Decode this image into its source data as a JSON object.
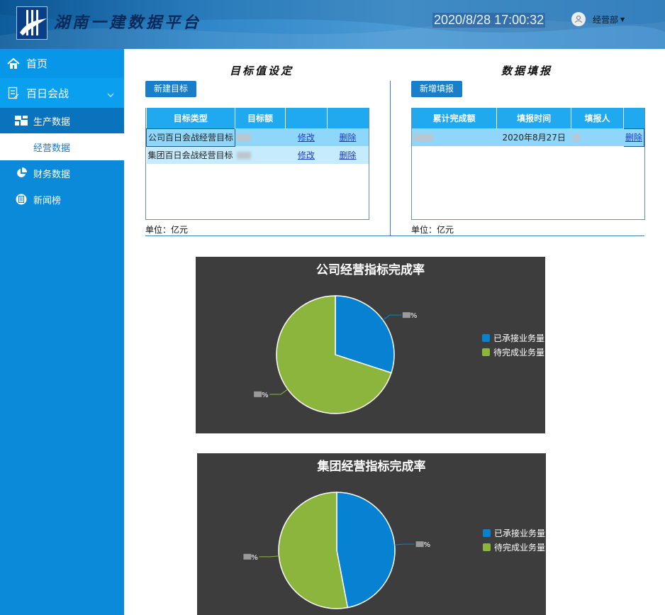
{
  "header": {
    "app_title": "湖南一建数据平台",
    "datetime": "2020/8/28 17:00:32",
    "user": "经营部"
  },
  "sidebar": {
    "items": [
      {
        "label": "首页",
        "icon": "home-icon"
      },
      {
        "label": "百日会战",
        "icon": "campaign-icon"
      },
      {
        "label": "生产数据",
        "icon": "dashboard-icon"
      },
      {
        "label": "经营数据"
      },
      {
        "label": "财务数据",
        "icon": "pie-icon"
      },
      {
        "label": "新闻榜",
        "icon": "news-icon"
      }
    ]
  },
  "targets": {
    "title": "目标值设定",
    "new_button": "新建目标",
    "columns": [
      "目标类型",
      "目标额",
      "",
      ""
    ],
    "rows": [
      {
        "type": "公司百日会战经营目标",
        "edit": "修改",
        "delete": "删除"
      },
      {
        "type": "集团百日会战经营目标",
        "edit": "修改",
        "delete": "删除"
      }
    ],
    "unit": "单位：亿元"
  },
  "reports": {
    "title": "数据填报",
    "new_button": "新增填报",
    "columns": [
      "累计完成额",
      "填报时间",
      "填报人",
      ""
    ],
    "rows": [
      {
        "time": "2020年8月27日",
        "delete": "删除"
      }
    ],
    "unit": "单位：亿元"
  },
  "colors": {
    "accent": "#1a7fca",
    "undertaken": "#0781d1",
    "pending": "#8bb53c",
    "chart_bg": "#3d3d3d"
  },
  "chart_data": [
    {
      "type": "pie",
      "title": "公司经营指标完成率",
      "series": [
        {
          "name": "已承接业务量",
          "value": 30
        },
        {
          "name": "待完成业务量",
          "value": 70
        }
      ],
      "legend_position": "right"
    },
    {
      "type": "pie",
      "title": "集团经营指标完成率",
      "series": [
        {
          "name": "已承接业务量",
          "value": 47
        },
        {
          "name": "待完成业务量",
          "value": 53
        }
      ],
      "legend_position": "right"
    }
  ]
}
